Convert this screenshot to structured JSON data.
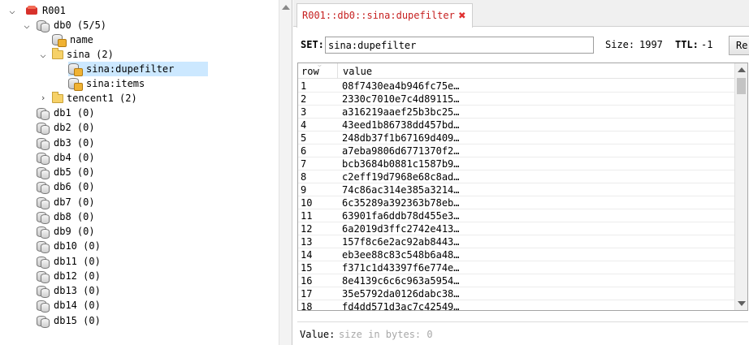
{
  "tree": {
    "server": {
      "name": "R001"
    },
    "db0": {
      "label": "db0  (5/5)"
    },
    "db0_items": [
      {
        "label": "name"
      }
    ],
    "sina": {
      "label": "sina (2)"
    },
    "sina_items": [
      {
        "label": "sina:dupefilter",
        "selected": true
      },
      {
        "label": "sina:items"
      }
    ],
    "tencent": {
      "label": "tencent1 (2)"
    },
    "databases": [
      {
        "label": "db1  (0)"
      },
      {
        "label": "db2  (0)"
      },
      {
        "label": "db3  (0)"
      },
      {
        "label": "db4  (0)"
      },
      {
        "label": "db5  (0)"
      },
      {
        "label": "db6  (0)"
      },
      {
        "label": "db7  (0)"
      },
      {
        "label": "db8  (0)"
      },
      {
        "label": "db9  (0)"
      },
      {
        "label": "db10  (0)"
      },
      {
        "label": "db11  (0)"
      },
      {
        "label": "db12  (0)"
      },
      {
        "label": "db13  (0)"
      },
      {
        "label": "db14  (0)"
      },
      {
        "label": "db15  (0)"
      }
    ]
  },
  "tab": {
    "title": "R001::db0::sina:dupefilter",
    "close_icon": "close-icon",
    "color": "#c62020"
  },
  "key_bar": {
    "set_label": "SET:",
    "key_value": "sina:dupefilter",
    "size_label": "Size:",
    "size_value": "1997",
    "ttl_label": "TTL:",
    "ttl_value": "-1",
    "rename_label": "Re"
  },
  "table": {
    "headers": {
      "row": "row",
      "value": "value"
    },
    "rows": [
      {
        "row": "1",
        "value": "08f7430ea4b946fc75e…"
      },
      {
        "row": "2",
        "value": "2330c7010e7c4d89115…"
      },
      {
        "row": "3",
        "value": "a316219aaef25b3bc25…"
      },
      {
        "row": "4",
        "value": "43eed1b86738dd457bd…"
      },
      {
        "row": "5",
        "value": "248db37f1b67169d409…"
      },
      {
        "row": "6",
        "value": "a7eba9806d6771370f2…"
      },
      {
        "row": "7",
        "value": "bcb3684b0881c1587b9…"
      },
      {
        "row": "8",
        "value": "c2eff19d7968e68c8ad…"
      },
      {
        "row": "9",
        "value": "74c86ac314e385a3214…"
      },
      {
        "row": "10",
        "value": "6c35289a392363b78eb…"
      },
      {
        "row": "11",
        "value": "63901fa6ddb78d455e3…"
      },
      {
        "row": "12",
        "value": "6a2019d3ffc2742e413…"
      },
      {
        "row": "13",
        "value": "157f8c6e2ac92ab8443…"
      },
      {
        "row": "14",
        "value": "eb3ee88c83c548b6a48…"
      },
      {
        "row": "15",
        "value": "f371c1d43397f6e774e…"
      },
      {
        "row": "16",
        "value": "8e4139c6c6c963a5954…"
      },
      {
        "row": "17",
        "value": "35e5792da0126dabc38…"
      },
      {
        "row": "18",
        "value": "fd4dd571d3ac7c42549…"
      }
    ]
  },
  "value_panel": {
    "label": "Value:",
    "hint": "size in bytes: 0"
  }
}
